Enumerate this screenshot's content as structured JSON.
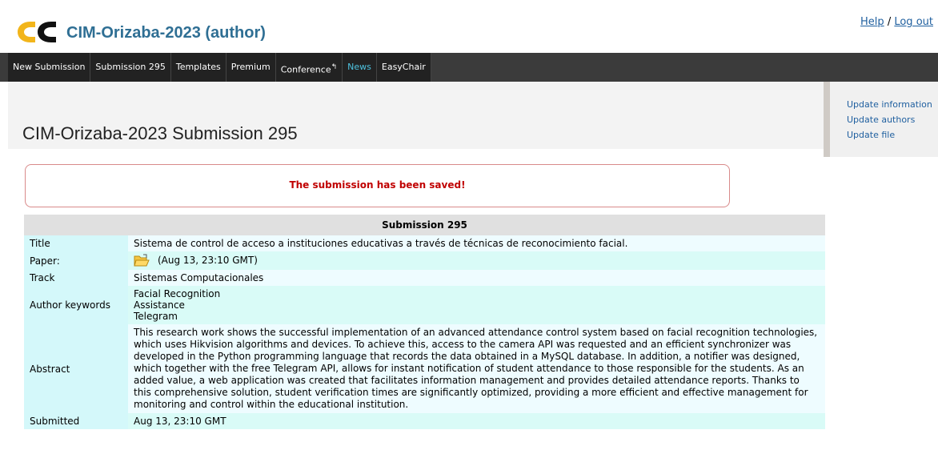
{
  "header": {
    "app_title": "CIM-Orizaba-2023 (author)",
    "help_label": "Help",
    "separator": "/",
    "logout_label": "Log out"
  },
  "menu": [
    {
      "label": "New Submission"
    },
    {
      "label": "Submission 295"
    },
    {
      "label": "Templates"
    },
    {
      "label": "Premium"
    },
    {
      "label": "Conference"
    },
    {
      "label": "News"
    },
    {
      "label": "EasyChair"
    }
  ],
  "page": {
    "title": "CIM-Orizaba-2023 Submission 295",
    "notice": "The submission has been saved!"
  },
  "sidebar": {
    "links": [
      "Update information",
      "Update authors",
      "Update file"
    ]
  },
  "submission": {
    "heading": "Submission 295",
    "rows": [
      {
        "label": "Title",
        "value": "Sistema de control de acceso a instituciones educativas a través de técnicas de reconocimiento facial."
      },
      {
        "label": "Paper:",
        "value": "(Aug 13, 23:10 GMT)"
      },
      {
        "label": "Track",
        "value": "Sistemas Computacionales"
      },
      {
        "label": "Author keywords",
        "keywords": [
          "Facial Recognition",
          "Assistance",
          "Telegram"
        ]
      },
      {
        "label": "Abstract",
        "value": "This research work shows the successful implementation of an advanced attendance control system based on facial recognition technologies, which uses Hikvision algorithms and devices. To achieve this, access to the camera API was requested and an efficient synchronizer was developed in the Python programming language that records the data obtained in a MySQL database. In addition, a notifier was designed, which together with the free Telegram API, allows for instant notification of student attendance to those responsible for the students. As an added value, a web application was created that facilitates information management and provides detailed attendance reports. Thanks to this comprehensive solution, student verification times are significantly optimized, providing a more efficient and effective management for monitoring and control within the educational institution."
      },
      {
        "label": "Submitted",
        "value": "Aug 13, 23:10 GMT"
      }
    ]
  },
  "icons": {
    "logo": "easychair-logo",
    "paper": "folder-open-icon"
  },
  "colors": {
    "title": "#2f6f94",
    "notice": "#c00000",
    "menu_bg": "#3b3b3b",
    "news": "#4ec3e0"
  }
}
